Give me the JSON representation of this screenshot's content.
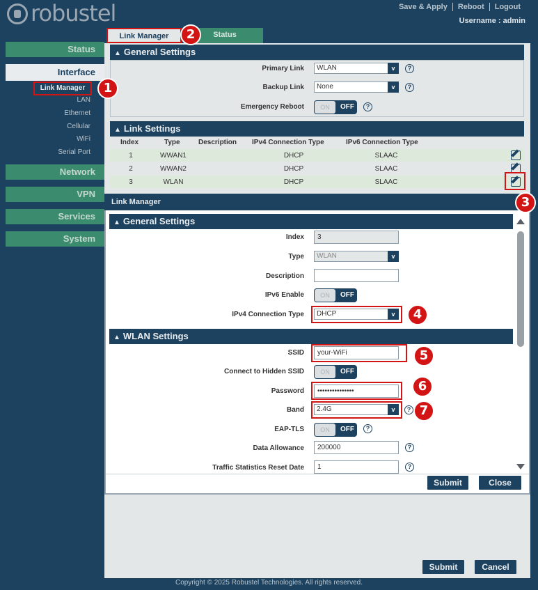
{
  "brand": {
    "name": "robustel"
  },
  "topnav": {
    "save_apply": "Save & Apply",
    "reboot": "Reboot",
    "logout": "Logout",
    "username": "Username : admin"
  },
  "sidebar": {
    "status": "Status",
    "interface": "Interface",
    "sub": [
      "Link Manager",
      "LAN",
      "Ethernet",
      "Cellular",
      "WiFi",
      "Serial Port"
    ],
    "network": "Network",
    "vpn": "VPN",
    "services": "Services",
    "system": "System"
  },
  "tabs": {
    "link_manager": "Link Manager",
    "status": "Status"
  },
  "general": {
    "title": "General Settings",
    "primary_label": "Primary Link",
    "primary_value": "WLAN",
    "backup_label": "Backup Link",
    "backup_value": "None",
    "reboot_label": "Emergency Reboot"
  },
  "toggle": {
    "on": "ON",
    "off": "OFF"
  },
  "link_settings": {
    "title": "Link Settings",
    "headers": [
      "Index",
      "Type",
      "Description",
      "IPv4 Connection Type",
      "IPv6 Connection Type"
    ],
    "rows": [
      {
        "index": "1",
        "type": "WWAN1",
        "description": "",
        "ipv4": "DHCP",
        "ipv6": "SLAAC"
      },
      {
        "index": "2",
        "type": "WWAN2",
        "description": "",
        "ipv4": "DHCP",
        "ipv6": "SLAAC"
      },
      {
        "index": "3",
        "type": "WLAN",
        "description": "",
        "ipv4": "DHCP",
        "ipv6": "SLAAC"
      }
    ]
  },
  "modal": {
    "title": "Link Manager",
    "general_title": "General Settings",
    "index_label": "Index",
    "index_value": "3",
    "type_label": "Type",
    "type_value": "WLAN",
    "desc_label": "Description",
    "desc_value": "",
    "ipv6_label": "IPv6 Enable",
    "ipv4_label": "IPv4 Connection Type",
    "ipv4_value": "DHCP",
    "wlan_title": "WLAN Settings",
    "ssid_label": "SSID",
    "ssid_value": "your-WiFi",
    "hidden_label": "Connect to Hidden SSID",
    "password_label": "Password",
    "password_value": "•••••••••••••••",
    "band_label": "Band",
    "band_value": "2.4G",
    "eap_label": "EAP-TLS",
    "allowance_label": "Data Allowance",
    "allowance_value": "200000",
    "reset_label": "Traffic Statistics Reset Date",
    "reset_value": "1",
    "submit": "Submit",
    "close": "Close"
  },
  "page_buttons": {
    "submit": "Submit",
    "cancel": "Cancel"
  },
  "badges": [
    "1",
    "2",
    "3",
    "4",
    "5",
    "6",
    "7"
  ],
  "colors": {
    "navy": "#1d4260",
    "green": "#3b8c6e",
    "highlight": "#d21414"
  },
  "footer": "Copyright © 2025 Robustel Technologies. All rights reserved."
}
